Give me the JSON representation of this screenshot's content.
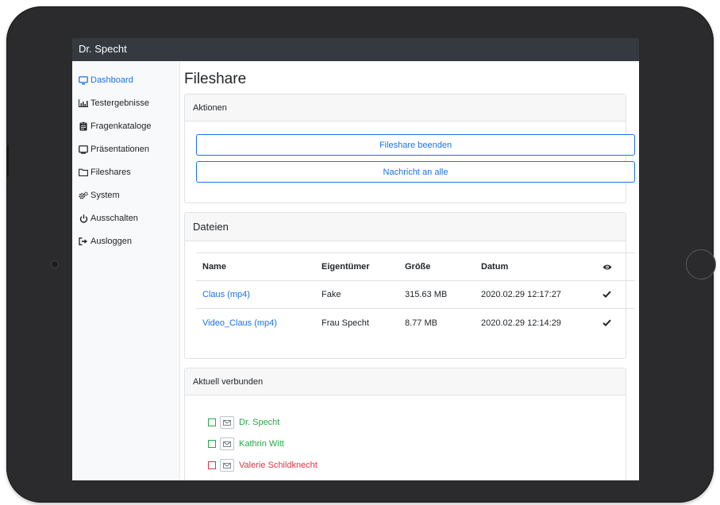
{
  "app": {
    "brand": "Dr. Specht"
  },
  "sidebar": {
    "items": [
      {
        "label": "Dashboard",
        "icon": "monitor-icon",
        "active": true
      },
      {
        "label": "Testergebnisse",
        "icon": "chart-icon",
        "active": false
      },
      {
        "label": "Fragenkataloge",
        "icon": "clipboard-icon",
        "active": false
      },
      {
        "label": "Präsentationen",
        "icon": "presentation-icon",
        "active": false
      },
      {
        "label": "Fileshares",
        "icon": "folder-icon",
        "active": false
      },
      {
        "label": "System",
        "icon": "cogs-icon",
        "active": false
      },
      {
        "label": "Ausschalten",
        "icon": "power-icon",
        "active": false
      },
      {
        "label": "Ausloggen",
        "icon": "sign-out-icon",
        "active": false
      }
    ]
  },
  "main": {
    "title": "Fileshare",
    "actions": {
      "header": "Aktionen",
      "buttons": [
        "Fileshare beenden",
        "Nachricht an alle"
      ]
    },
    "files": {
      "header": "Dateien",
      "columns": [
        "Name",
        "Eigentümer",
        "Größe",
        "Datum"
      ],
      "eye_column_icon": "eye-icon",
      "rows": [
        {
          "name": "Claus (mp4)",
          "owner": "Fake",
          "size": "315.63 MB",
          "date": "2020.02.29 12:17:27",
          "seen": true
        },
        {
          "name": "Video_Claus (mp4)",
          "owner": "Frau Specht",
          "size": "8.77 MB",
          "date": "2020.02.29 12:14:29",
          "seen": true
        }
      ]
    },
    "connected": {
      "header": "Aktuell verbunden",
      "users": [
        {
          "name": "Dr. Specht",
          "status": "online"
        },
        {
          "name": "Kathrin Witt",
          "status": "online"
        },
        {
          "name": "Valerie Schildknecht",
          "status": "offline"
        }
      ]
    }
  },
  "colors": {
    "navbar": "#343a40",
    "accent": "#1a73e8",
    "online": "#28a745",
    "offline": "#dc3545",
    "bezel": "#2b2b2d"
  }
}
